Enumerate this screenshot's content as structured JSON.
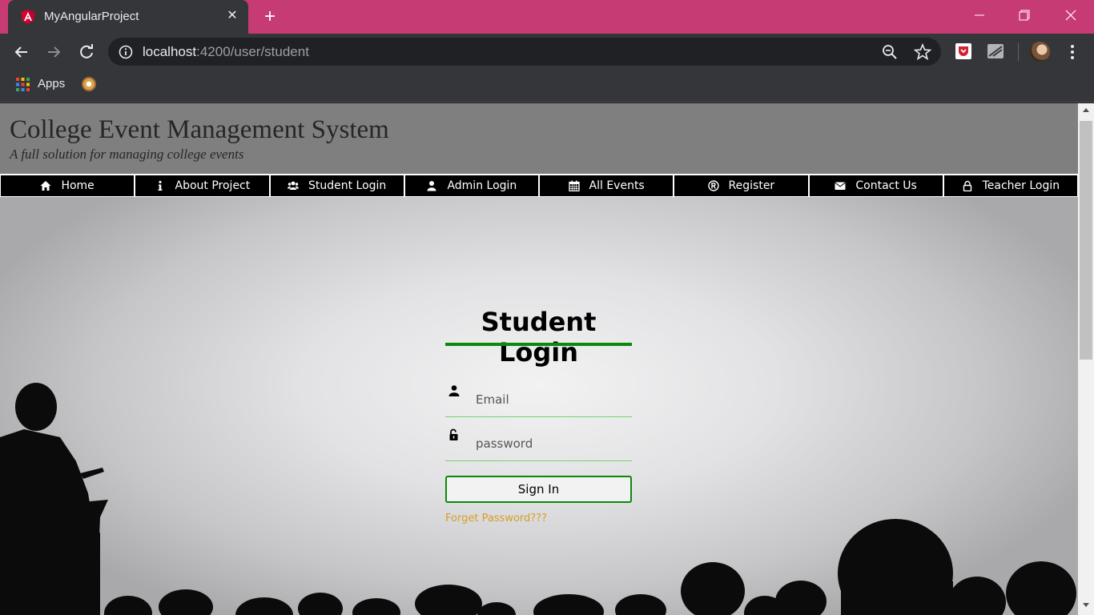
{
  "browser": {
    "tab_title": "MyAngularProject",
    "url_host": "localhost",
    "url_rest": ":4200/user/student",
    "bookmarks": {
      "apps_label": "Apps"
    },
    "colors": {
      "tabstrip": "#c73b74",
      "toolbar": "#35363a"
    }
  },
  "header": {
    "title": "College Event Management System",
    "subtitle": "A full solution for managing college events"
  },
  "nav": {
    "items": [
      {
        "label": "Home",
        "icon": "home-icon"
      },
      {
        "label": "About Project",
        "icon": "info-icon"
      },
      {
        "label": "Student Login",
        "icon": "users-icon"
      },
      {
        "label": "Admin Login",
        "icon": "user-icon"
      },
      {
        "label": "All Events",
        "icon": "calendar-icon"
      },
      {
        "label": "Register",
        "icon": "registered-icon"
      },
      {
        "label": "Contact Us",
        "icon": "envelope-icon"
      },
      {
        "label": "Teacher Login",
        "icon": "lock-icon"
      }
    ]
  },
  "login": {
    "title": "Student Login",
    "email_placeholder": "Email",
    "password_placeholder": "password",
    "signin_label": "Sign In",
    "forgot_label": "Forget Password???",
    "colors": {
      "accent": "#0a8a0a",
      "field_line": "#6fd36f",
      "link": "#d4a026"
    }
  }
}
